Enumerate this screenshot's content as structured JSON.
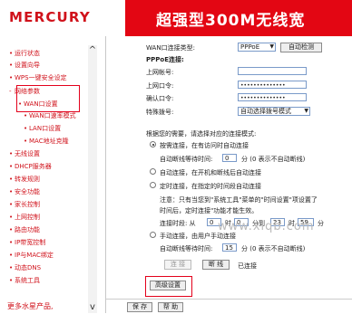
{
  "header": {
    "logo": "MERCURY",
    "banner_title": "超强型300M无线宽"
  },
  "sidebar": {
    "items": [
      {
        "label": "运行状态",
        "type": "top"
      },
      {
        "label": "设置向导",
        "type": "top"
      },
      {
        "label": "WPS一键安全设定",
        "type": "top"
      },
      {
        "label": "网络参数",
        "type": "top-open"
      },
      {
        "label": "WAN口设置",
        "type": "sub"
      },
      {
        "label": "WAN口速率模式",
        "type": "sub"
      },
      {
        "label": "LAN口设置",
        "type": "sub"
      },
      {
        "label": "MAC地址克隆",
        "type": "sub"
      },
      {
        "label": "无线设置",
        "type": "top"
      },
      {
        "label": "DHCP服务器",
        "type": "top"
      },
      {
        "label": "转发规则",
        "type": "top"
      },
      {
        "label": "安全功能",
        "type": "top"
      },
      {
        "label": "家长控制",
        "type": "top"
      },
      {
        "label": "上网控制",
        "type": "top"
      },
      {
        "label": "路由功能",
        "type": "top"
      },
      {
        "label": "IP带宽控制",
        "type": "top"
      },
      {
        "label": "IP与MAC绑定",
        "type": "top"
      },
      {
        "label": "动态DNS",
        "type": "top"
      },
      {
        "label": "系统工具",
        "type": "top"
      }
    ],
    "more": "更多水星产品,"
  },
  "form": {
    "wan_type_label": "WAN口连接类型:",
    "wan_type_value": "PPPoE",
    "auto_detect": "自动检测",
    "pppoe_heading": "PPPoE连接:",
    "account_label": "上网帐号:",
    "password_label": "上网口令:",
    "password_value": "••••••••••••••",
    "confirm_label": "确认口令:",
    "confirm_value": "••••••••••••••",
    "dial_label": "特殊拨号:",
    "dial_value": "自动选择拨号模式",
    "mode_heading": "根据您的需要，请选择对应的连接模式:",
    "opt1": "按需连接，在有访问时自动连接",
    "opt1_sub_pre": "自动断线等待时间:",
    "opt1_sub_value": "0",
    "opt1_sub_post": "分 (0 表示不自动断线)",
    "opt2": "自动连接，在开机和断线后自动连接",
    "opt3": "定时连接，在指定的时间段自动连接",
    "note_line1": "注意：只有当您到\"系统工具\"菜单的\"时间设置\"项设置了",
    "note_line2": "时间后，定时连接\"功能才能生效。",
    "period_pre": "连接时段: 从",
    "period_h1": "0",
    "period_t1": "时",
    "period_m1": "0",
    "period_t2": "分到",
    "period_h2": "23",
    "period_t3": "时",
    "period_m2": "59",
    "period_t4": "分",
    "opt4": "手动连接，由用户手动连接",
    "opt4_sub_pre": "自动断线等待时间:",
    "opt4_sub_value": "15",
    "opt4_sub_post": "分 (0 表示不自动断线)",
    "connect_btn": "连 接",
    "disconnect_btn": "断 线",
    "status": "已连接",
    "advanced_btn": "高级设置",
    "save_btn": "保 存",
    "help_btn": "帮 助"
  },
  "watermark": "www.xlqb.com",
  "colors": {
    "brand_red": "#e30613",
    "highlight_red": "#e3001b"
  }
}
